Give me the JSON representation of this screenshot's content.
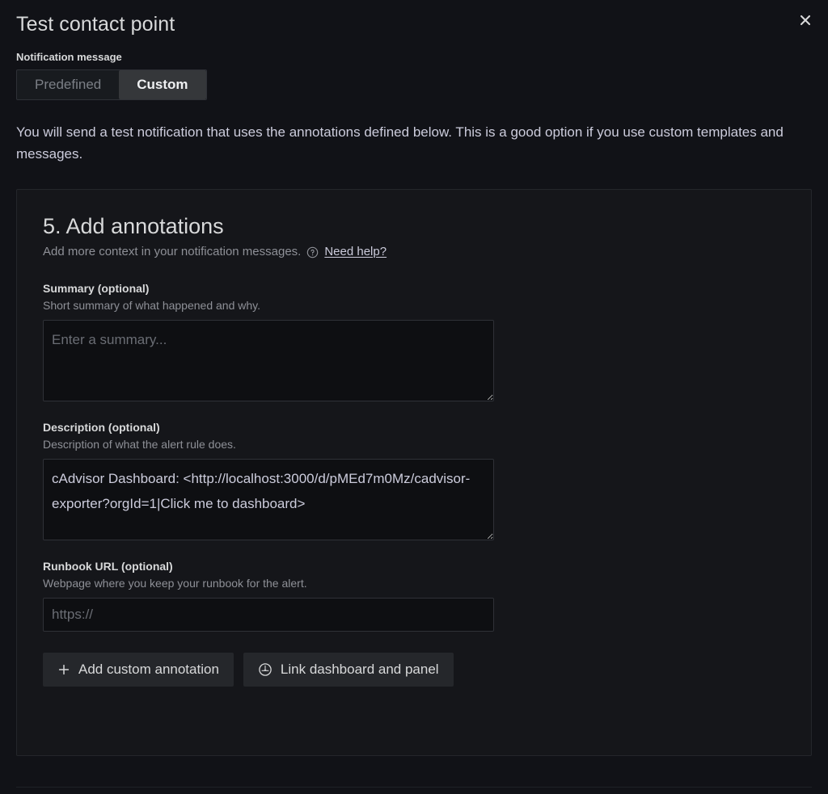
{
  "modal": {
    "title": "Test contact point",
    "close_label": "Close",
    "close_icon": "close-icon"
  },
  "notification_message": {
    "label": "Notification message",
    "options": [
      {
        "label": "Predefined",
        "selected": false
      },
      {
        "label": "Custom",
        "selected": true
      }
    ]
  },
  "intro_text": "You will send a test notification that uses the annotations defined below. This is a good option if you use custom templates and messages.",
  "step": {
    "title": "5. Add annotations",
    "description": "Add more context in your notification messages.",
    "help_icon": "question-circle-icon",
    "help_link": "Need help?"
  },
  "fields": [
    {
      "label": "Summary (optional)",
      "sublabel": "Short summary of what happened and why.",
      "placeholder": "Enter a summary...",
      "value": ""
    },
    {
      "label": "Description (optional)",
      "sublabel": "Description of what the alert rule does.",
      "placeholder": "",
      "value": "cAdvisor Dashboard: <http://localhost:3000/d/pMEd7m0Mz/cadvisor-exporter?orgId=1|Click me to dashboard>"
    },
    {
      "label": "Runbook URL (optional)",
      "sublabel": "Webpage where you keep your runbook for the alert.",
      "placeholder": "https://",
      "value": ""
    }
  ],
  "buttons": [
    {
      "label": "Add custom annotation",
      "icon": "plus-icon"
    },
    {
      "label": "Link dashboard and panel",
      "icon": "apps-dashboard-icon"
    }
  ],
  "colors": {
    "background": "#111217",
    "panel_bg": "#15161a",
    "input_bg": "#0e0f12",
    "border": "#2f3137",
    "text_primary": "#ccccdc",
    "text_secondary": "#8e9097",
    "selected_bg": "#35373a"
  }
}
